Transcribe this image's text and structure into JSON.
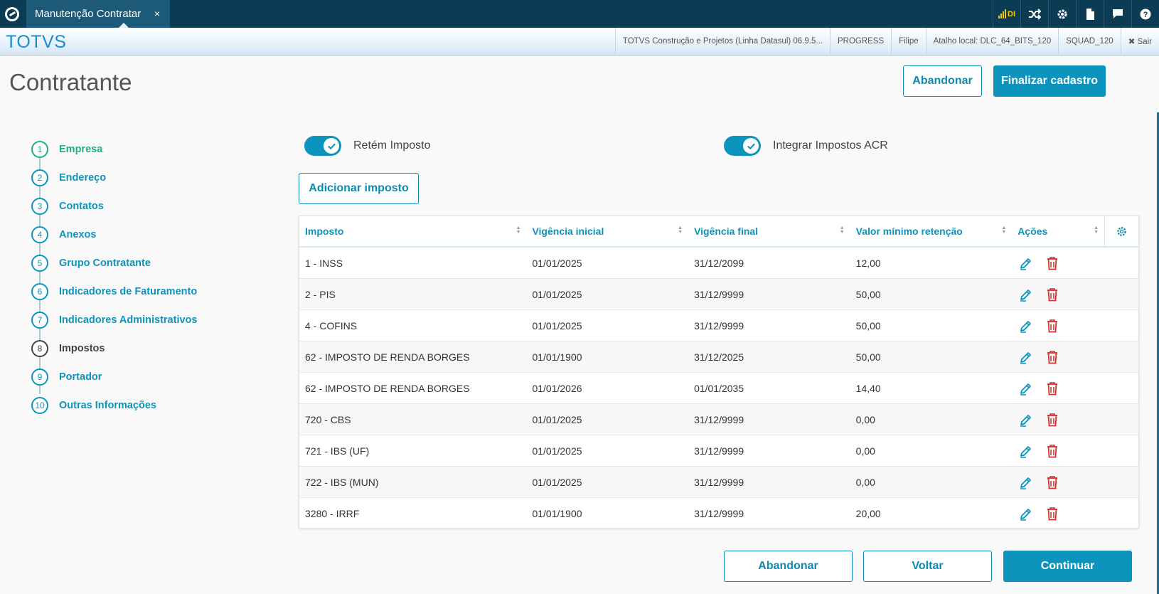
{
  "topbar": {
    "tab_title": "Manutenção Contratar",
    "tab_close": "×",
    "signal_label": "DI",
    "icons": [
      "shuffle-icon",
      "gear-icon",
      "document-icon",
      "chat-icon",
      "help-icon"
    ]
  },
  "header": {
    "brand": "TOTVS",
    "items": [
      "TOTVS Construção e Projetos (Linha Datasul) 06.9.5...",
      "PROGRESS",
      "Filipe",
      "Atalho local: DLC_64_BITS_120",
      "SQUAD_120",
      "✖ Sair"
    ]
  },
  "page": {
    "title": "Contratante",
    "abandon_label": "Abandonar",
    "finish_label": "Finalizar cadastro"
  },
  "steps": [
    {
      "num": "1",
      "label": "Empresa",
      "state": "done"
    },
    {
      "num": "2",
      "label": "Endereço",
      "state": "pending"
    },
    {
      "num": "3",
      "label": "Contatos",
      "state": "pending"
    },
    {
      "num": "4",
      "label": "Anexos",
      "state": "pending"
    },
    {
      "num": "5",
      "label": "Grupo Contratante",
      "state": "pending"
    },
    {
      "num": "6",
      "label": "Indicadores de Faturamento",
      "state": "pending"
    },
    {
      "num": "7",
      "label": "Indicadores Administrativos",
      "state": "pending"
    },
    {
      "num": "8",
      "label": "Impostos",
      "state": "active"
    },
    {
      "num": "9",
      "label": "Portador",
      "state": "pending"
    },
    {
      "num": "10",
      "label": "Outras Informações",
      "state": "pending"
    }
  ],
  "switches": {
    "retem_label": "Retém Imposto",
    "integrar_label": "Integrar Impostos ACR"
  },
  "add_tax_label": "Adicionar imposto",
  "table": {
    "columns": [
      "Imposto",
      "Vigência inicial",
      "Vigência final",
      "Valor mínimo retenção",
      "Ações"
    ],
    "rows": [
      [
        "1 - INSS",
        "01/01/2025",
        "31/12/2099",
        "12,00"
      ],
      [
        "2 - PIS",
        "01/01/2025",
        "31/12/9999",
        "50,00"
      ],
      [
        "4 - COFINS",
        "01/01/2025",
        "31/12/9999",
        "50,00"
      ],
      [
        "62 - IMPOSTO DE RENDA BORGES",
        "01/01/1900",
        "31/12/2025",
        "50,00"
      ],
      [
        "62 - IMPOSTO DE RENDA BORGES",
        "01/01/2026",
        "01/01/2035",
        "14,40"
      ],
      [
        "720 - CBS",
        "01/01/2025",
        "31/12/9999",
        "0,00"
      ],
      [
        "721 - IBS (UF)",
        "01/01/2025",
        "31/12/9999",
        "0,00"
      ],
      [
        "722 - IBS (MUN)",
        "01/01/2025",
        "31/12/9999",
        "0,00"
      ],
      [
        "3280 - IRRF",
        "01/01/1900",
        "31/12/9999",
        "20,00"
      ]
    ]
  },
  "footer": {
    "abandon_label": "Abandonar",
    "back_label": "Voltar",
    "continue_label": "Continuar"
  },
  "colors": {
    "primary": "#0c94bd",
    "done": "#1faf7f",
    "delete": "#d0312d",
    "topbar": "#0c3b54"
  }
}
